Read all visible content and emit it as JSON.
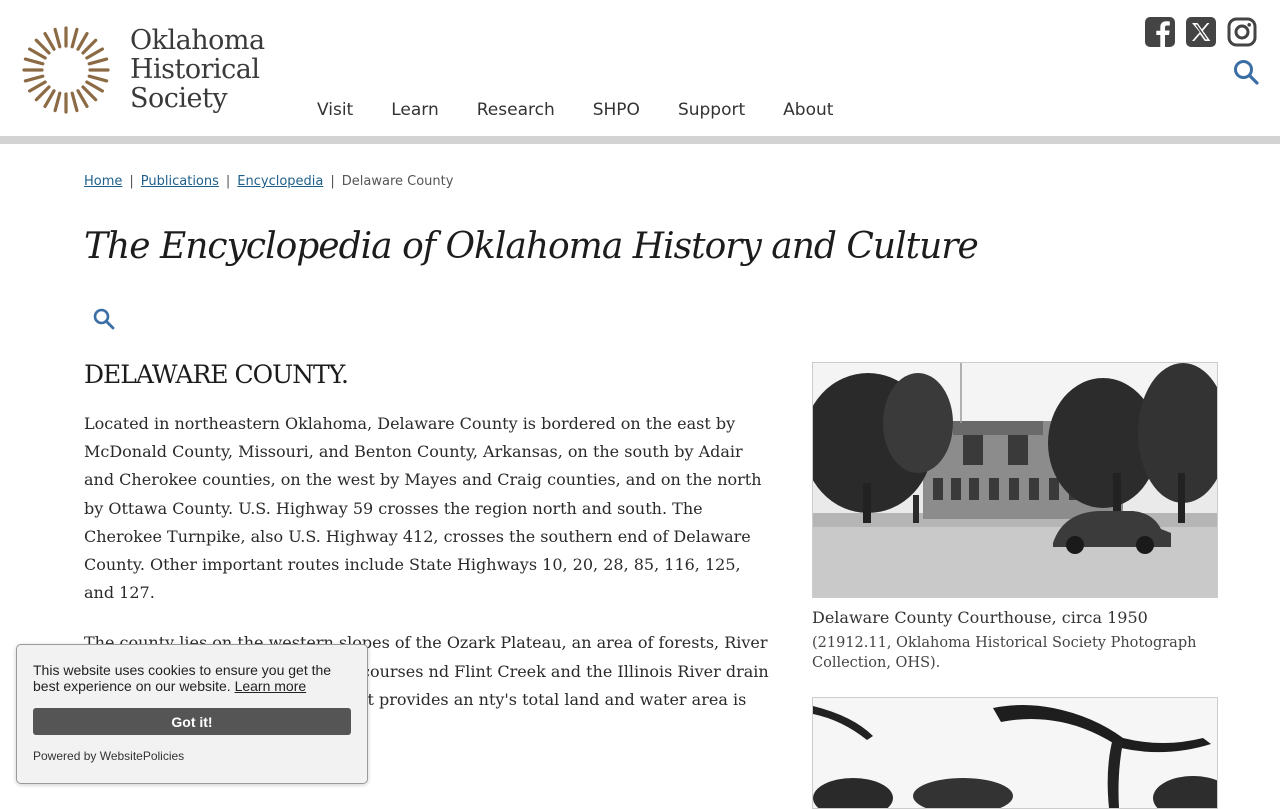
{
  "site": {
    "logo_line1": "Oklahoma",
    "logo_line2": "Historical",
    "logo_line3": "Society",
    "brand_color": "#8b6a44"
  },
  "nav": {
    "items": [
      {
        "label": "Visit"
      },
      {
        "label": "Learn"
      },
      {
        "label": "Research"
      },
      {
        "label": "SHPO"
      },
      {
        "label": "Support"
      },
      {
        "label": "About"
      }
    ]
  },
  "social": {
    "icons": [
      "facebook-icon",
      "x-icon",
      "instagram-icon"
    ],
    "search_icon": "search-icon",
    "accent_color": "#3a6ea5"
  },
  "breadcrumb": {
    "home": "Home",
    "publications": "Publications",
    "encyclopedia": "Encyclopedia",
    "current": "Delaware County",
    "separator": "|"
  },
  "page_title": "The Encyclopedia of Oklahoma History and Culture",
  "article": {
    "title": "DELAWARE COUNTY.",
    "paragraphs": [
      "Located in northeastern Oklahoma, Delaware County is bordered on the east by McDonald County, Missouri, and Benton County, Arkansas, on the south by Adair and Cherokee counties, on the west by Mayes and Craig counties, and on the north by Ottawa County. U.S. Highway 59 crosses the region north and south. The Cherokee Turnpike, also U.S. Highway 412, crosses the southern end of Delaware County. Other important routes include State Highways 10, 20, 28, 85, 116, 125, and 127.",
      "The county lies on the western slopes of the Ozark Plateau, an area of forests, River and Elk River are the major watercourses nd Flint Creek and the Illinois River drain in the e holds no oil or minerals but provides an nty's total land and water area is 792.33 square miles."
    ]
  },
  "figure1": {
    "caption": "Delaware County Courthouse, circa 1950",
    "credit": "(21912.11, Oklahoma Historical Society Photograph Collection, OHS)."
  },
  "cookie": {
    "text": "This website uses cookies to ensure you get the best experience on our website.",
    "learn_more": "Learn more",
    "button": "Got it!",
    "powered_by": "Powered by WebsitePolicies"
  }
}
